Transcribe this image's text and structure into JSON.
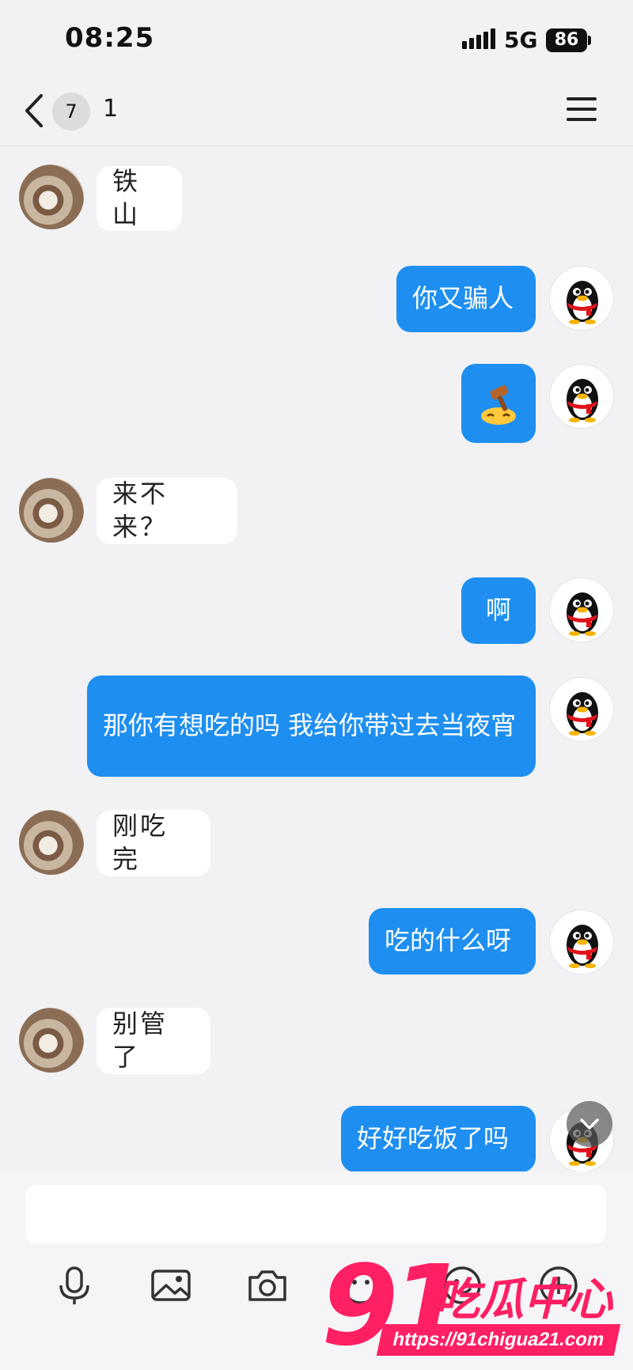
{
  "status_bar": {
    "time": "08:25",
    "network": "5G",
    "battery": "86"
  },
  "nav": {
    "unread_count": "7",
    "title": "1"
  },
  "messages": [
    {
      "side": "in",
      "text": "铁山"
    },
    {
      "side": "out",
      "text": "你又骗人"
    },
    {
      "side": "out",
      "text": "",
      "sticker": "gavel-hammer-emoji"
    },
    {
      "side": "in",
      "text": "来不来？"
    },
    {
      "side": "out",
      "text": "啊"
    },
    {
      "side": "out",
      "text": "那你有想吃的吗 我给你带过去当夜宵"
    },
    {
      "side": "in",
      "text": "刚吃完"
    },
    {
      "side": "out",
      "text": "吃的什么呀"
    },
    {
      "side": "in",
      "text": "别管了"
    },
    {
      "side": "out",
      "text": "好好吃饭了吗"
    }
  ],
  "input": {
    "placeholder": ""
  },
  "toolbar": [
    "microphone-icon",
    "image-icon",
    "camera-icon",
    "emoji-icon",
    "smile-icon",
    "plus-icon"
  ],
  "watermark": {
    "number": "91",
    "text": "吃瓜中心",
    "url": "https://91chigua21.com"
  },
  "colors": {
    "outgoing_bubble": "#1e8ff0",
    "incoming_bubble": "#ffffff",
    "background": "#f2f2f4",
    "watermark": "#ff1f63"
  }
}
